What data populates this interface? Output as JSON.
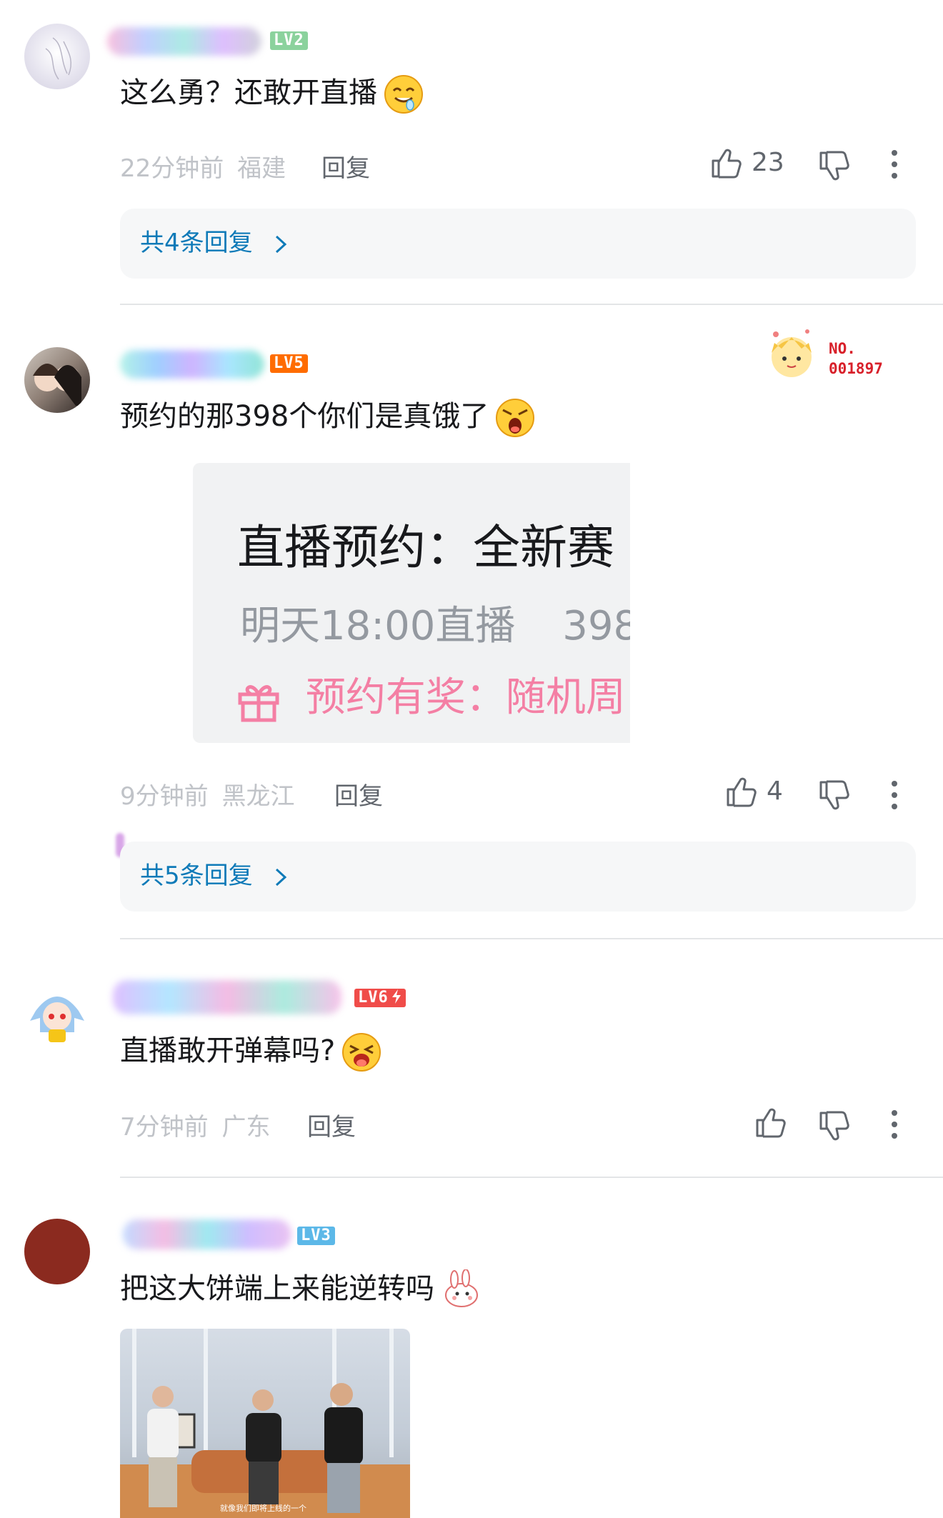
{
  "comments": [
    {
      "level": "LV2",
      "text": "这么勇？还敢开直播",
      "time": "22分钟前",
      "location": "福建",
      "reply_label": "回复",
      "likes": "23",
      "replies_label": "共4条回复",
      "level_color": "#8bd29d"
    },
    {
      "level": "LV5",
      "text": "预约的那398个你们是真饿了",
      "time": "9分钟前",
      "location": "黑龙江",
      "reply_label": "回复",
      "likes": "4",
      "replies_label": "共5条回复",
      "level_color": "#ff6c00",
      "badge": {
        "line1": "NO.",
        "line2": "001897"
      },
      "embedded_screenshot": {
        "title": "直播预约：全新赛",
        "time_line": "明天18:00直播",
        "count_partial": "398",
        "reward_line": "预约有奖：随机周"
      }
    },
    {
      "level": "LV6",
      "text": "直播敢开弹幕吗?",
      "time": "7分钟前",
      "location": "广东",
      "reply_label": "回复",
      "level_color": "#f04c49"
    },
    {
      "level": "LV3",
      "text": "把这大饼端上来能逆转吗",
      "level_color": "#5cb8e8",
      "image_caption": "就像我们即将上线的一个"
    }
  ],
  "icons": {
    "like": "thumbs-up-icon",
    "dislike": "thumbs-down-icon",
    "more": "more-vertical-icon",
    "chevron": "chevron-right-icon",
    "gift": "gift-icon"
  },
  "colors": {
    "link": "#0e7ab8",
    "meta": "#c0c3c8",
    "text": "#18191c",
    "reward": "#f47fa4"
  }
}
